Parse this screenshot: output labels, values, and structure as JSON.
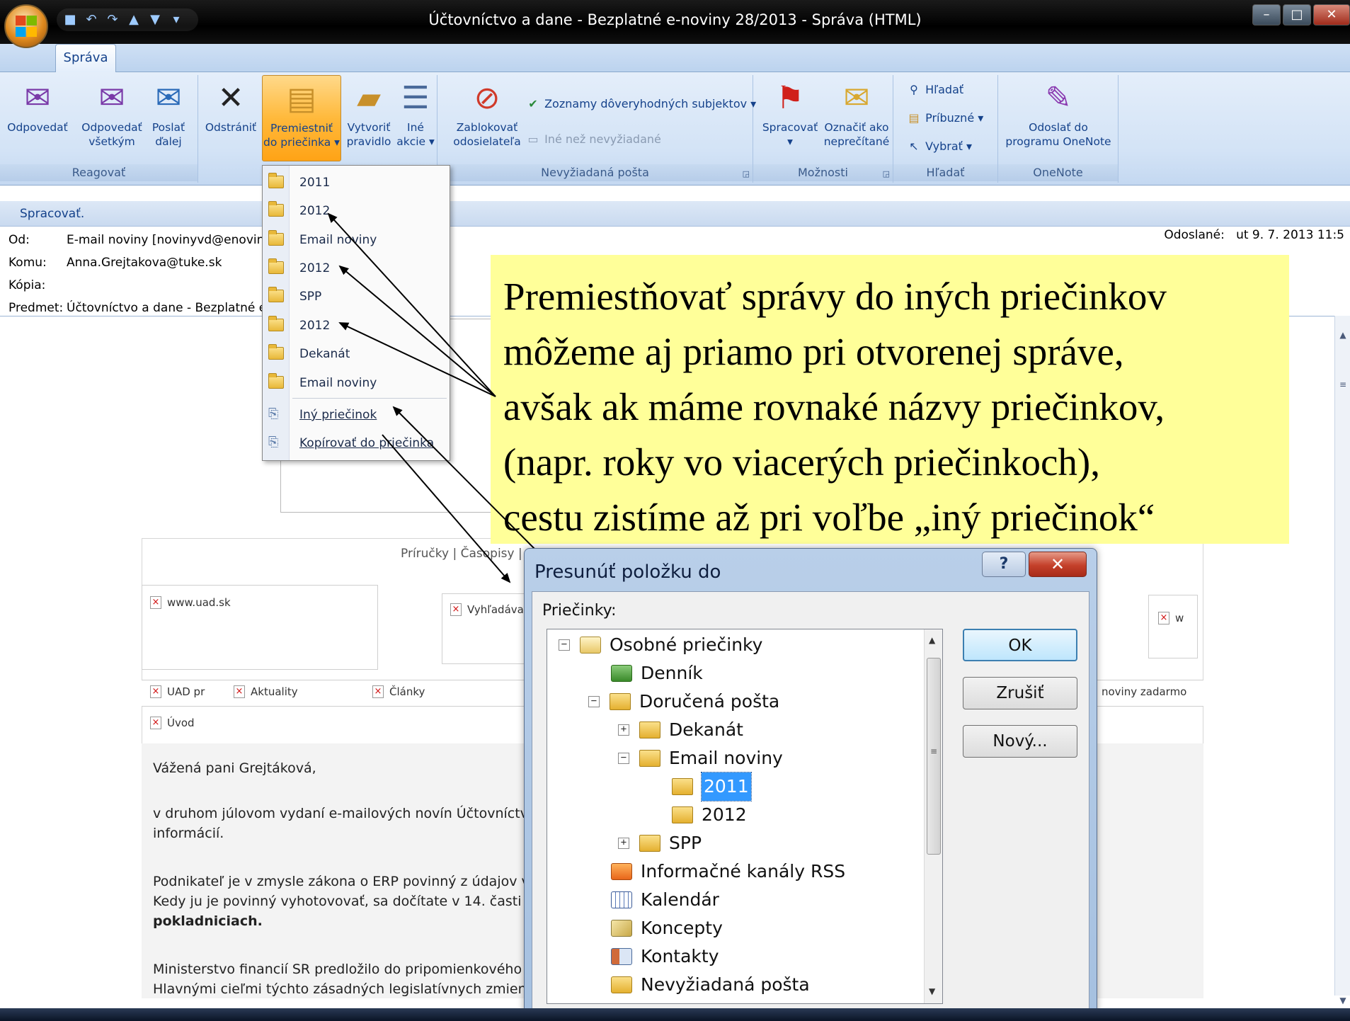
{
  "window": {
    "title": "Účtovníctvo a dane - Bezplatné e-noviny 28/2013 - Správa (HTML)"
  },
  "ribbon": {
    "tab": "Správa",
    "groups": {
      "reagovat": {
        "label": "Reagovať",
        "reply": "Odpovedať",
        "reply_all_l1": "Odpovedať",
        "reply_all_l2": "všetkým",
        "forward_l1": "Poslať",
        "forward_l2": "ďalej"
      },
      "actions": {
        "delete": "Odstrániť",
        "move_l1": "Premiestniť",
        "move_l2": "do priečinka",
        "rule_l1": "Vytvoriť",
        "rule_l2": "pravidlo",
        "other_l1": "Iné",
        "other_l2": "akcie"
      },
      "junk": {
        "label": "Nevyžiadaná pošta",
        "block_l1": "Zablokovať",
        "block_l2": "odosielateľa",
        "safe_lists": "Zoznamy dôveryhodných subjektov",
        "not_junk": "Iné než nevyžiadané"
      },
      "options": {
        "label": "Možnosti",
        "followup": "Spracovať",
        "mark_l1": "Označiť ako",
        "mark_l2": "neprečítané"
      },
      "find": {
        "label": "Hľadať",
        "find": "Hľadať",
        "related": "Príbuzné",
        "select": "Vybrať"
      },
      "onenote": {
        "label": "OneNote",
        "send_l1": "Odoslať do",
        "send_l2": "programu OneNote"
      }
    }
  },
  "message": {
    "infobar": "Spracovať.",
    "from_label": "Od:",
    "from": "E-mail noviny  [novinyvd@enoviny.s",
    "to_label": "Komu:",
    "to": "Anna.Grejtakova@tuke.sk",
    "cc_label": "Kópia:",
    "cc": "",
    "subject_label": "Predmet:",
    "subject": "Účtovníctvo a dane - Bezplatné e-n",
    "sent_label": "Odoslané:",
    "sent": "ut 9. 7. 2013 11:5"
  },
  "dropdown": {
    "items": [
      "2011",
      "2012",
      "Email noviny",
      "2012",
      "SPP",
      "2012",
      "Dekanát",
      "Email noviny"
    ],
    "other_folder": "Iný priečinok",
    "copy_to_folder": "Kopírovať do priečinka"
  },
  "newsletter": {
    "links": "Príručky | Časopisy |",
    "img1": "www.uad.sk",
    "img2": "Vyhľadáva",
    "img_right": "w",
    "nav1": "UAD pr",
    "nav2": "Aktuality",
    "nav3": "Články",
    "nav_right": "noviny zadarmo",
    "intro": "Úvod",
    "greeting": "Vážená pani Grejtáková,",
    "p1_l1": "v druhom júlovom vydaní e-mailových novín Účtovníctvo a",
    "p1_l2": "informácií.",
    "p2_l1": "Podnikateľ je v zmysle zákona o ERP povinný z údajov v p",
    "p2_l2": "Kedy ju je povinný vyhotovovať, sa dočítate v 14. časti se",
    "p2_l3": "pokladniciach.",
    "p3_l1": "Ministerstvo financií SR predložilo do pripomienkového ko",
    "p3_l2": "Hlavnými cieľmi týchto zásadných legislatívnych zmien je z"
  },
  "callout": {
    "lines": [
      "Premiestňovať správy do iných priečinkov",
      "môžeme aj priamo pri otvorenej správe,",
      "avšak ak máme rovnaké názvy priečinkov,",
      "(napr. roky vo viacerých priečinkoch),",
      "cestu zistíme až pri voľbe „iný priečinok“"
    ]
  },
  "dialog": {
    "title": "Presunúť položku do",
    "folders_label": "Priečinky:",
    "ok": "OK",
    "cancel": "Zrušiť",
    "new": "Nový...",
    "tree": [
      {
        "label": "Osobné priečinky",
        "toggle": "−",
        "icon": "personal-folders-icon"
      },
      {
        "label": "Denník",
        "toggle": "",
        "icon": "journal-icon"
      },
      {
        "label": "Doručená pošta",
        "toggle": "−",
        "icon": "inbox-icon"
      },
      {
        "label": "Dekanát",
        "toggle": "+",
        "icon": "folder-icon"
      },
      {
        "label": "Email noviny",
        "toggle": "−",
        "icon": "folder-icon"
      },
      {
        "label": "2011",
        "toggle": "",
        "icon": "folder-icon",
        "selected": true
      },
      {
        "label": "2012",
        "toggle": "",
        "icon": "folder-icon"
      },
      {
        "label": "SPP",
        "toggle": "+",
        "icon": "folder-icon"
      },
      {
        "label": "Informačné kanály RSS",
        "toggle": "",
        "icon": "rss-icon"
      },
      {
        "label": "Kalendár",
        "toggle": "",
        "icon": "calendar-icon"
      },
      {
        "label": "Koncepty",
        "toggle": "",
        "icon": "drafts-icon"
      },
      {
        "label": "Kontakty",
        "toggle": "",
        "icon": "contacts-icon"
      },
      {
        "label": "Nevyžiadaná pošta",
        "toggle": "",
        "icon": "junk-mail-icon"
      }
    ]
  },
  "colors": {
    "callout_bg": "#ffff99",
    "ribbon_bg": "#d3e3f6",
    "active_button": "#ffb93b",
    "selection": "#3399ff"
  }
}
